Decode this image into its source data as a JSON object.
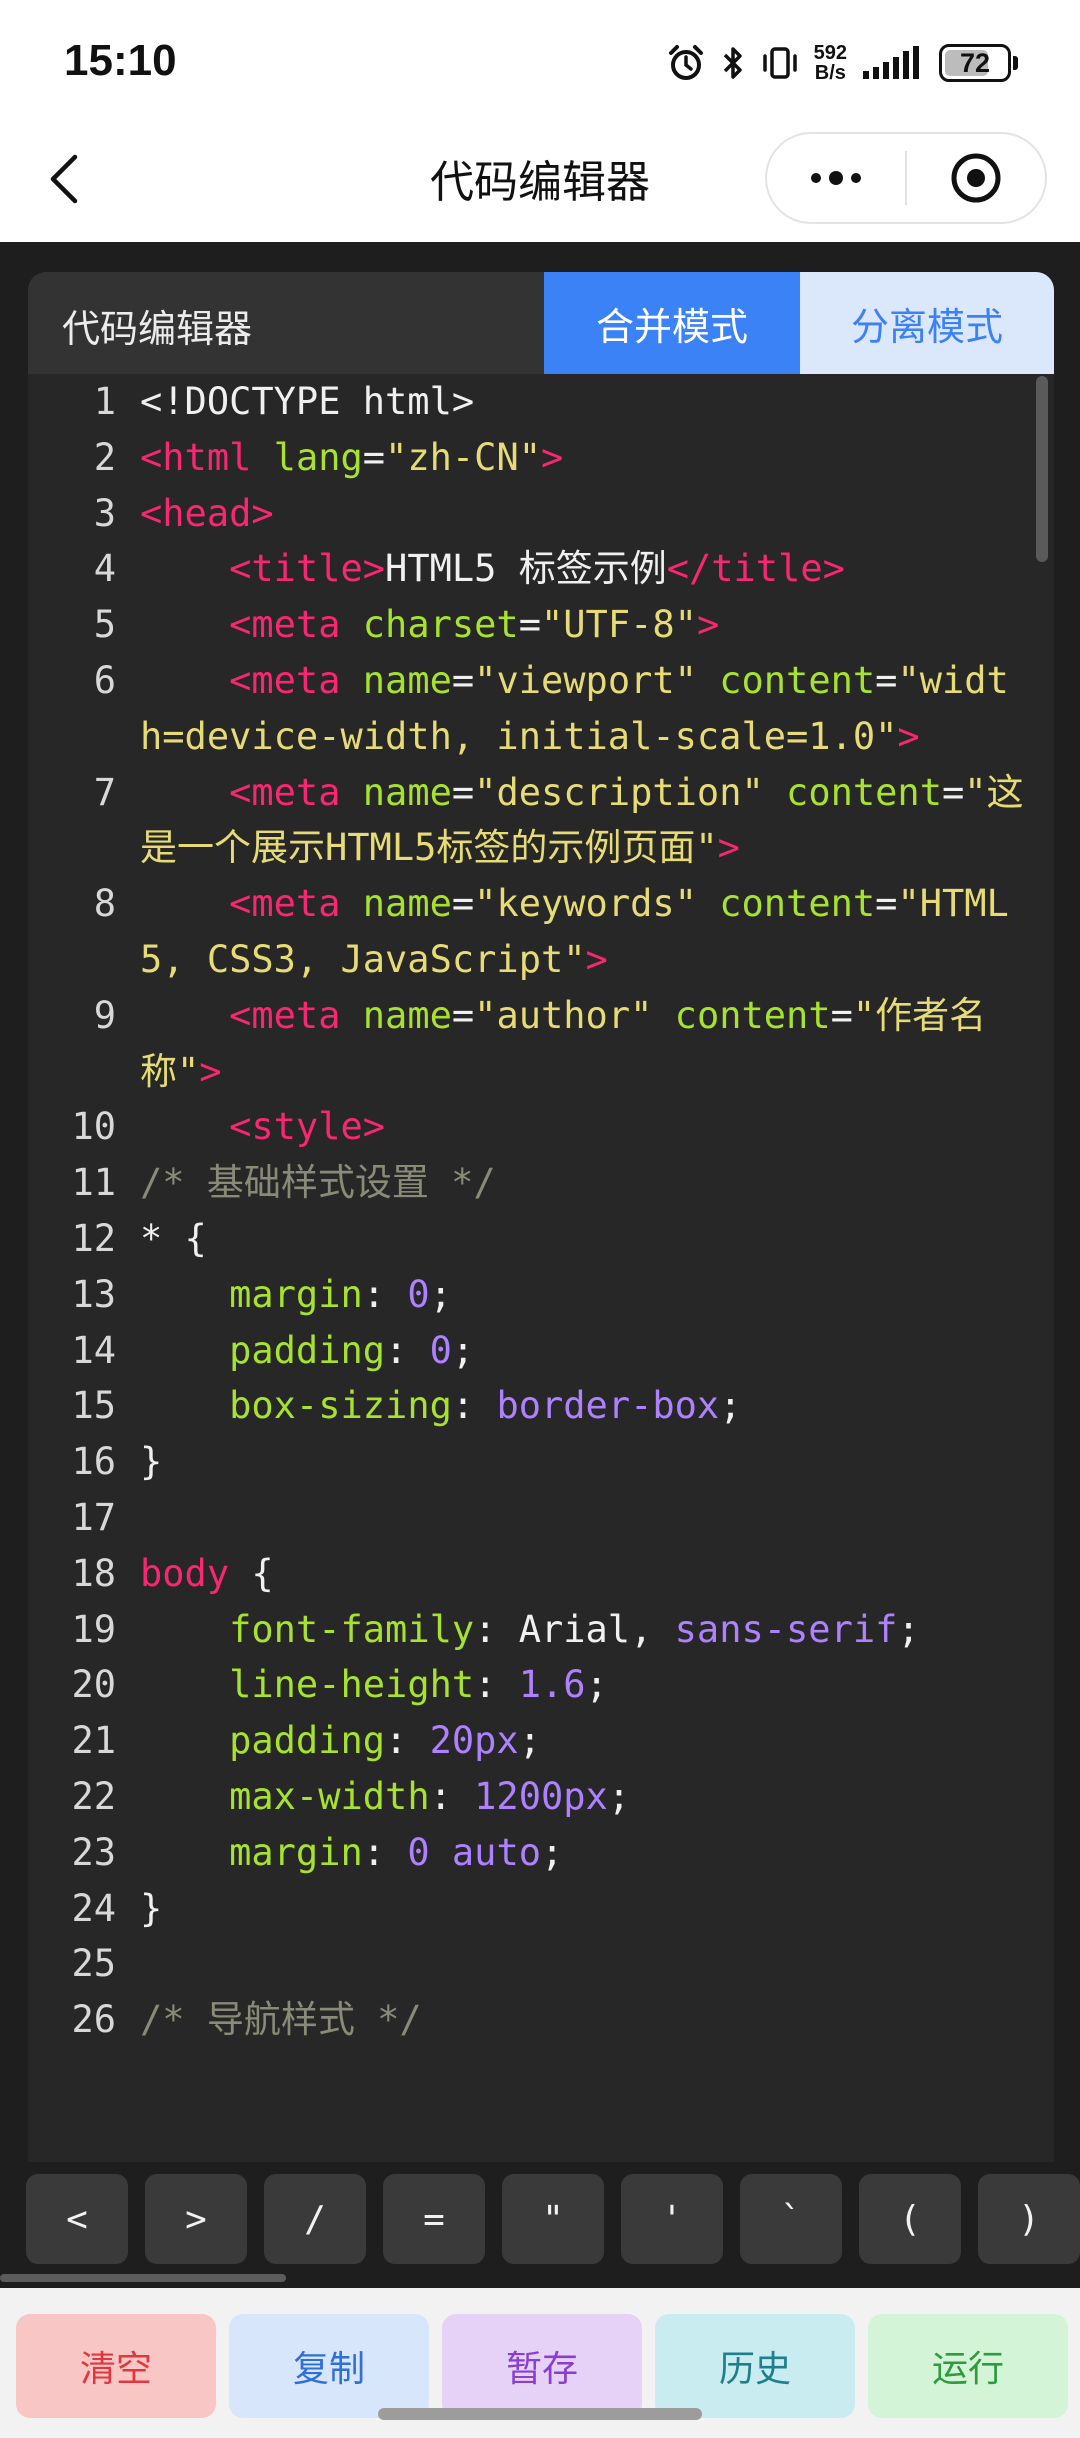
{
  "status_bar": {
    "time": "15:10",
    "net_speed_value": "592",
    "net_speed_unit": "B/s",
    "battery": "72",
    "battery_level": 0.72,
    "icons": [
      "alarm-icon",
      "bluetooth-icon",
      "vibrate-icon",
      "signal-icon",
      "battery-icon"
    ]
  },
  "title_bar": {
    "title": "代码编辑器",
    "icons": [
      "back-arrow-icon",
      "more-dots-icon",
      "target-close-icon"
    ]
  },
  "editor": {
    "label": "代码编辑器",
    "modes": {
      "merge": "合并模式",
      "split": "分离模式",
      "active": "merge"
    },
    "lines": [
      {
        "n": "1",
        "tokens": [
          {
            "t": "text",
            "v": "<!DOCTYPE html>"
          }
        ]
      },
      {
        "n": "2",
        "tokens": [
          {
            "t": "tag",
            "v": "<html"
          },
          {
            "t": "punc",
            "v": " "
          },
          {
            "t": "attr",
            "v": "lang"
          },
          {
            "t": "punc",
            "v": "="
          },
          {
            "t": "str",
            "v": "\"zh-CN\""
          },
          {
            "t": "tag",
            "v": ">"
          }
        ]
      },
      {
        "n": "3",
        "tokens": [
          {
            "t": "tag",
            "v": "<head>"
          }
        ]
      },
      {
        "n": "4",
        "tokens": [
          {
            "t": "punc",
            "v": "    "
          },
          {
            "t": "tag",
            "v": "<title>"
          },
          {
            "t": "text",
            "v": "HTML5 标签示例"
          },
          {
            "t": "tag",
            "v": "</title>"
          }
        ]
      },
      {
        "n": "5",
        "tokens": [
          {
            "t": "punc",
            "v": "    "
          },
          {
            "t": "tag",
            "v": "<meta"
          },
          {
            "t": "punc",
            "v": " "
          },
          {
            "t": "attr",
            "v": "charset"
          },
          {
            "t": "punc",
            "v": "="
          },
          {
            "t": "str",
            "v": "\"UTF-8\""
          },
          {
            "t": "tag",
            "v": ">"
          }
        ]
      },
      {
        "n": "6",
        "tokens": [
          {
            "t": "punc",
            "v": "    "
          },
          {
            "t": "tag",
            "v": "<meta"
          },
          {
            "t": "punc",
            "v": " "
          },
          {
            "t": "attr",
            "v": "name"
          },
          {
            "t": "punc",
            "v": "="
          },
          {
            "t": "str",
            "v": "\"viewport\""
          },
          {
            "t": "punc",
            "v": " "
          },
          {
            "t": "attr",
            "v": "content"
          },
          {
            "t": "punc",
            "v": "="
          },
          {
            "t": "str",
            "v": "\"width=device-width, initial-scale=1.0\""
          },
          {
            "t": "tag",
            "v": ">"
          }
        ]
      },
      {
        "n": "7",
        "tokens": [
          {
            "t": "punc",
            "v": "    "
          },
          {
            "t": "tag",
            "v": "<meta"
          },
          {
            "t": "punc",
            "v": " "
          },
          {
            "t": "attr",
            "v": "name"
          },
          {
            "t": "punc",
            "v": "="
          },
          {
            "t": "str",
            "v": "\"description\""
          },
          {
            "t": "punc",
            "v": " "
          },
          {
            "t": "attr",
            "v": "content"
          },
          {
            "t": "punc",
            "v": "="
          },
          {
            "t": "str",
            "v": "\"这是一个展示HTML5标签的示例页面\""
          },
          {
            "t": "tag",
            "v": ">"
          }
        ]
      },
      {
        "n": "8",
        "tokens": [
          {
            "t": "punc",
            "v": "    "
          },
          {
            "t": "tag",
            "v": "<meta"
          },
          {
            "t": "punc",
            "v": " "
          },
          {
            "t": "attr",
            "v": "name"
          },
          {
            "t": "punc",
            "v": "="
          },
          {
            "t": "str",
            "v": "\"keywords\""
          },
          {
            "t": "punc",
            "v": " "
          },
          {
            "t": "attr",
            "v": "content"
          },
          {
            "t": "punc",
            "v": "="
          },
          {
            "t": "str",
            "v": "\"HTML5, CSS3, JavaScript\""
          },
          {
            "t": "tag",
            "v": ">"
          }
        ]
      },
      {
        "n": "9",
        "tokens": [
          {
            "t": "punc",
            "v": "    "
          },
          {
            "t": "tag",
            "v": "<meta"
          },
          {
            "t": "punc",
            "v": " "
          },
          {
            "t": "attr",
            "v": "name"
          },
          {
            "t": "punc",
            "v": "="
          },
          {
            "t": "str",
            "v": "\"author\""
          },
          {
            "t": "punc",
            "v": " "
          },
          {
            "t": "attr",
            "v": "content"
          },
          {
            "t": "punc",
            "v": "="
          },
          {
            "t": "str",
            "v": "\"作者名称\""
          },
          {
            "t": "tag",
            "v": ">"
          }
        ]
      },
      {
        "n": "10",
        "tokens": [
          {
            "t": "punc",
            "v": "    "
          },
          {
            "t": "tag",
            "v": "<style>"
          }
        ]
      },
      {
        "n": "11",
        "tokens": [
          {
            "t": "comment",
            "v": "/* 基础样式设置 */"
          }
        ]
      },
      {
        "n": "12",
        "tokens": [
          {
            "t": "punc",
            "v": "* {"
          }
        ]
      },
      {
        "n": "13",
        "tokens": [
          {
            "t": "punc",
            "v": "    "
          },
          {
            "t": "attr",
            "v": "margin"
          },
          {
            "t": "punc",
            "v": ": "
          },
          {
            "t": "num",
            "v": "0"
          },
          {
            "t": "punc",
            "v": ";"
          }
        ]
      },
      {
        "n": "14",
        "tokens": [
          {
            "t": "punc",
            "v": "    "
          },
          {
            "t": "attr",
            "v": "padding"
          },
          {
            "t": "punc",
            "v": ": "
          },
          {
            "t": "num",
            "v": "0"
          },
          {
            "t": "punc",
            "v": ";"
          }
        ]
      },
      {
        "n": "15",
        "tokens": [
          {
            "t": "punc",
            "v": "    "
          },
          {
            "t": "attr",
            "v": "box-sizing"
          },
          {
            "t": "punc",
            "v": ": "
          },
          {
            "t": "kw",
            "v": "border-box"
          },
          {
            "t": "punc",
            "v": ";"
          }
        ]
      },
      {
        "n": "16",
        "tokens": [
          {
            "t": "punc",
            "v": "}"
          }
        ]
      },
      {
        "n": "17",
        "tokens": []
      },
      {
        "n": "18",
        "tokens": [
          {
            "t": "sel",
            "v": "body"
          },
          {
            "t": "punc",
            "v": " {"
          }
        ]
      },
      {
        "n": "19",
        "tokens": [
          {
            "t": "punc",
            "v": "    "
          },
          {
            "t": "attr",
            "v": "font-family"
          },
          {
            "t": "punc",
            "v": ": Arial, "
          },
          {
            "t": "kw",
            "v": "sans-serif"
          },
          {
            "t": "punc",
            "v": ";"
          }
        ]
      },
      {
        "n": "20",
        "tokens": [
          {
            "t": "punc",
            "v": "    "
          },
          {
            "t": "attr",
            "v": "line-height"
          },
          {
            "t": "punc",
            "v": ": "
          },
          {
            "t": "num",
            "v": "1.6"
          },
          {
            "t": "punc",
            "v": ";"
          }
        ]
      },
      {
        "n": "21",
        "tokens": [
          {
            "t": "punc",
            "v": "    "
          },
          {
            "t": "attr",
            "v": "padding"
          },
          {
            "t": "punc",
            "v": ": "
          },
          {
            "t": "num",
            "v": "20px"
          },
          {
            "t": "punc",
            "v": ";"
          }
        ]
      },
      {
        "n": "22",
        "tokens": [
          {
            "t": "punc",
            "v": "    "
          },
          {
            "t": "attr",
            "v": "max-width"
          },
          {
            "t": "punc",
            "v": ": "
          },
          {
            "t": "num",
            "v": "1200px"
          },
          {
            "t": "punc",
            "v": ";"
          }
        ]
      },
      {
        "n": "23",
        "tokens": [
          {
            "t": "punc",
            "v": "    "
          },
          {
            "t": "attr",
            "v": "margin"
          },
          {
            "t": "punc",
            "v": ": "
          },
          {
            "t": "num",
            "v": "0"
          },
          {
            "t": "punc",
            "v": " "
          },
          {
            "t": "kw",
            "v": "auto"
          },
          {
            "t": "punc",
            "v": ";"
          }
        ]
      },
      {
        "n": "24",
        "tokens": [
          {
            "t": "punc",
            "v": "}"
          }
        ]
      },
      {
        "n": "25",
        "tokens": []
      },
      {
        "n": "26",
        "tokens": [
          {
            "t": "comment",
            "v": "/* 导航样式 */"
          }
        ]
      }
    ]
  },
  "symbols": [
    "<",
    ">",
    "/",
    "=",
    "\"",
    "'",
    "`",
    "(",
    ")"
  ],
  "actions": {
    "clear": "清空",
    "copy": "复制",
    "save": "暂存",
    "history": "历史",
    "run": "运行"
  },
  "colors": {
    "accent": "#3b82f6",
    "editor_bg": "#272727",
    "tag": "#f92672",
    "attr": "#a6e22e",
    "string": "#e6db74",
    "number": "#ae81ff",
    "comment": "#8a8a78"
  }
}
